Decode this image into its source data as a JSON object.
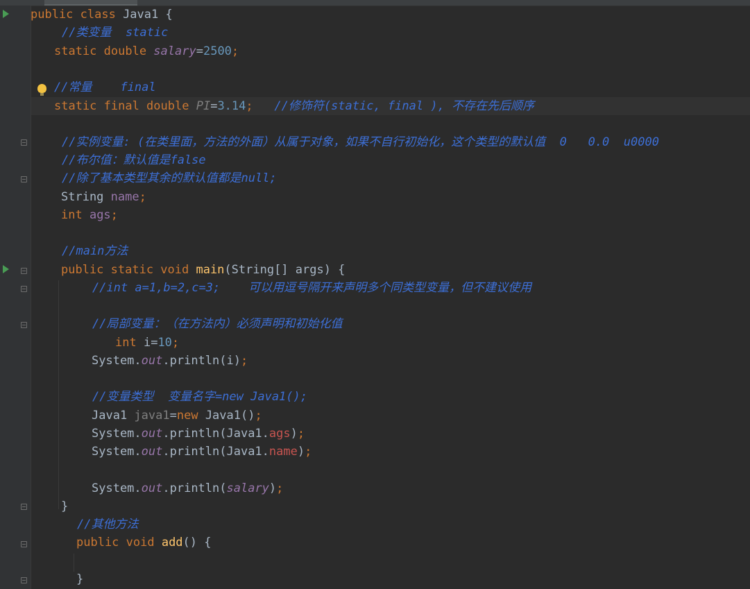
{
  "lines": [
    {
      "tokens": [
        {
          "t": "public class ",
          "c": "kw"
        },
        {
          "t": "Java1 {"
        }
      ]
    },
    {
      "tokens": [
        {
          "t": "//类变量  static",
          "c": "cmt"
        }
      ]
    },
    {
      "tokens": [
        {
          "t": "static double ",
          "c": "kw"
        },
        {
          "t": "salary",
          "c": "sfield"
        },
        {
          "t": "="
        },
        {
          "t": "2500",
          "c": "num"
        },
        {
          "t": ";",
          "c": "kw"
        }
      ]
    },
    {
      "tokens": [
        {
          "t": "//常量    final",
          "c": "cmt"
        }
      ]
    },
    {
      "tokens": [
        {
          "t": "static final double ",
          "c": "kw"
        },
        {
          "t": "PI",
          "c": "unusedi"
        },
        {
          "t": "="
        },
        {
          "t": "3.14",
          "c": "num"
        },
        {
          "t": ";",
          "c": "kw"
        },
        {
          "t": "   //修饰符(static, final ), 不存在先后顺序",
          "c": "cmt"
        }
      ]
    },
    {
      "tokens": [
        {
          "t": "//实例变量: (在类里面，方法的外面）从属于对象，如果不自行初始化，这个类型的默认值  0   0.0  u0000",
          "c": "cmt"
        }
      ]
    },
    {
      "tokens": [
        {
          "t": "//布尔值：默认值是false",
          "c": "cmt"
        }
      ]
    },
    {
      "tokens": [
        {
          "t": "//除了基本类型其余的默认值都是null;",
          "c": "cmt"
        }
      ]
    },
    {
      "tokens": [
        {
          "t": "String "
        },
        {
          "t": "name",
          "c": "field"
        },
        {
          "t": ";",
          "c": "kw"
        }
      ]
    },
    {
      "tokens": [
        {
          "t": "int ",
          "c": "kw"
        },
        {
          "t": "ags",
          "c": "field"
        },
        {
          "t": ";",
          "c": "kw"
        }
      ]
    },
    {
      "tokens": [
        {
          "t": "//main方法",
          "c": "cmt"
        }
      ]
    },
    {
      "tokens": [
        {
          "t": "public static void ",
          "c": "kw"
        },
        {
          "t": "main",
          "c": "fn"
        },
        {
          "t": "(String[] args) {"
        }
      ]
    },
    {
      "tokens": [
        {
          "t": "//int a=1,b=2,c=3;    可以用逗号隔开来声明多个同类型变量，但不建议使用",
          "c": "cmt"
        }
      ]
    },
    {
      "tokens": [
        {
          "t": "//局部变量：（在方法内）必须声明和初始化值",
          "c": "cmt"
        }
      ]
    },
    {
      "tokens": [
        {
          "t": "int ",
          "c": "kw"
        },
        {
          "t": "i="
        },
        {
          "t": "10",
          "c": "num"
        },
        {
          "t": ";",
          "c": "kw"
        }
      ]
    },
    {
      "tokens": [
        {
          "t": "System."
        },
        {
          "t": "out",
          "c": "sfield"
        },
        {
          "t": ".println(i)"
        },
        {
          "t": ";",
          "c": "kw"
        }
      ]
    },
    {
      "tokens": [
        {
          "t": "//变量类型  变量名字=new Java1();",
          "c": "cmt"
        }
      ]
    },
    {
      "tokens": [
        {
          "t": "Java1 "
        },
        {
          "t": "java1",
          "c": "unused"
        },
        {
          "t": "="
        },
        {
          "t": "new ",
          "c": "kw"
        },
        {
          "t": "Java1()"
        },
        {
          "t": ";",
          "c": "kw"
        }
      ]
    },
    {
      "tokens": [
        {
          "t": "System."
        },
        {
          "t": "out",
          "c": "sfield"
        },
        {
          "t": ".println(Java1."
        },
        {
          "t": "ags",
          "c": "red"
        },
        {
          "t": ")"
        },
        {
          "t": ";",
          "c": "kw"
        }
      ]
    },
    {
      "tokens": [
        {
          "t": "System."
        },
        {
          "t": "out",
          "c": "sfield"
        },
        {
          "t": ".println(Java1."
        },
        {
          "t": "name",
          "c": "red"
        },
        {
          "t": ")"
        },
        {
          "t": ";",
          "c": "kw"
        }
      ]
    },
    {
      "tokens": [
        {
          "t": "System."
        },
        {
          "t": "out",
          "c": "sfield"
        },
        {
          "t": ".println("
        },
        {
          "t": "salary",
          "c": "sfield"
        },
        {
          "t": ")"
        },
        {
          "t": ";",
          "c": "kw"
        }
      ]
    },
    {
      "tokens": [
        {
          "t": "}"
        }
      ]
    },
    {
      "tokens": [
        {
          "t": "//其他方法",
          "c": "cmt"
        }
      ]
    },
    {
      "tokens": [
        {
          "t": "public void ",
          "c": "kw"
        },
        {
          "t": "add",
          "c": "fn"
        },
        {
          "t": "() {"
        }
      ]
    },
    {
      "tokens": [
        {
          "t": "}"
        }
      ]
    }
  ],
  "icons": {
    "run": "run-gutter-icon",
    "fold": "fold-marker-icon",
    "intention": "lightbulb-icon"
  },
  "colors": {
    "background": "#2b2b2b",
    "keyword": "#cc7832",
    "comment": "#3d6fd6",
    "number": "#6897bb",
    "field": "#9876aa",
    "function": "#ffc66d",
    "error": "#c75450"
  }
}
